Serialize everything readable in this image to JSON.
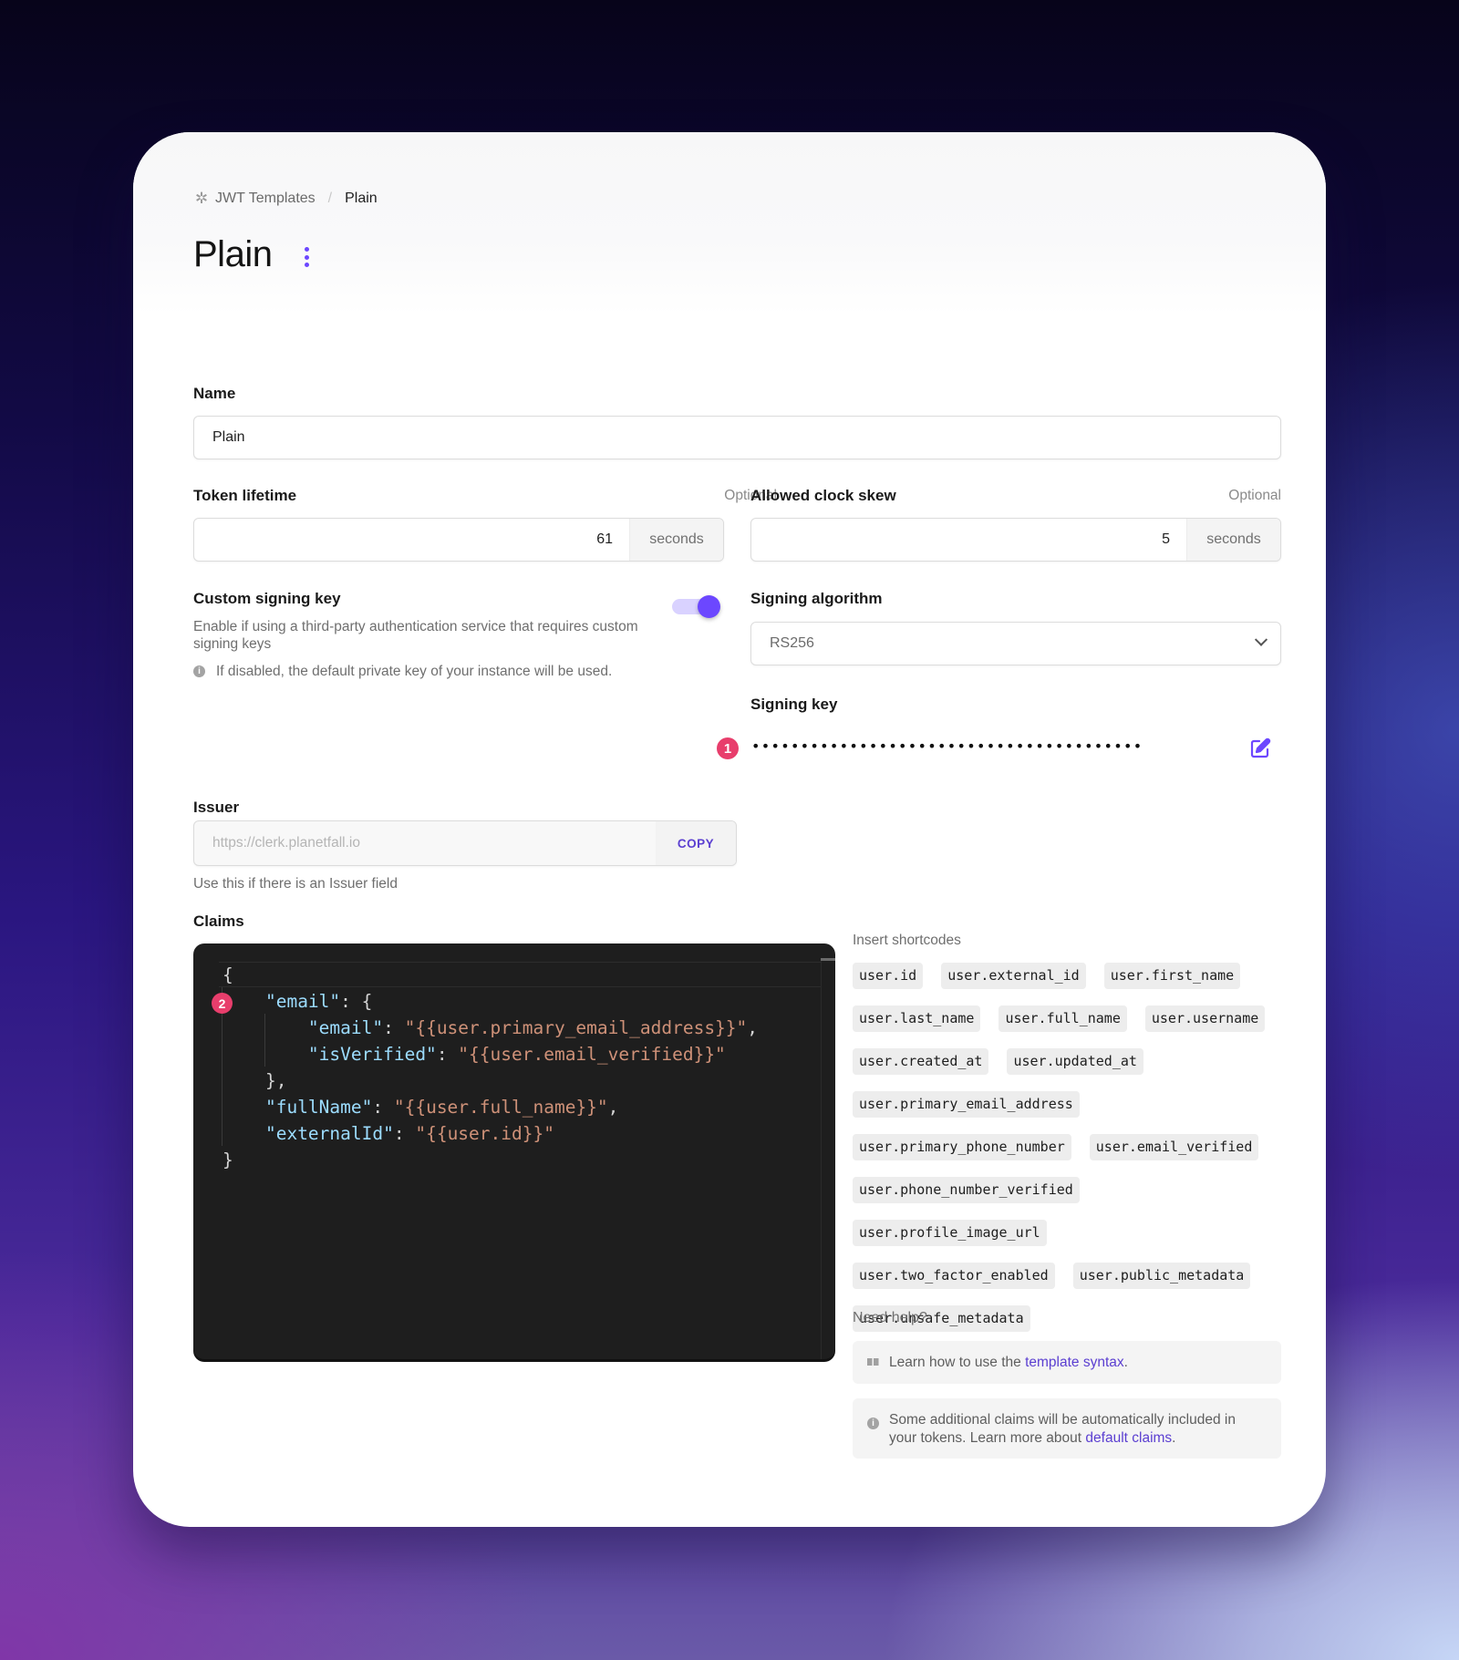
{
  "breadcrumb": {
    "parent": "JWT Templates",
    "separator": "/",
    "current": "Plain"
  },
  "page": {
    "title": "Plain"
  },
  "form": {
    "name": {
      "label": "Name",
      "value": "Plain"
    },
    "token_lifetime": {
      "label": "Token lifetime",
      "optional": "Optional",
      "value": "61",
      "unit": "seconds"
    },
    "clock_skew": {
      "label": "Allowed clock skew",
      "optional": "Optional",
      "value": "5",
      "unit": "seconds"
    },
    "custom_signing_key": {
      "label": "Custom signing key",
      "description": "Enable if using a third-party authentication service that requires custom signing keys",
      "note": "If disabled, the default private key of your instance will be used.",
      "enabled": true
    },
    "signing_algorithm": {
      "label": "Signing algorithm",
      "value": "RS256"
    },
    "signing_key": {
      "label": "Signing key",
      "masked": "••••••••••••••••••••••••••••••••••••••••",
      "badge": "1"
    },
    "issuer": {
      "label": "Issuer",
      "value": "https://clerk.planetfall.io",
      "copy_label": "COPY",
      "helper": "Use this if there is an Issuer field"
    },
    "claims": {
      "label": "Claims",
      "badge": "2",
      "lines": [
        [
          {
            "t": "p",
            "v": "{"
          }
        ],
        [
          {
            "t": "p",
            "v": "    "
          },
          {
            "t": "k",
            "v": "\"email\""
          },
          {
            "t": "p",
            "v": ": {"
          }
        ],
        [
          {
            "t": "p",
            "v": "        "
          },
          {
            "t": "k",
            "v": "\"email\""
          },
          {
            "t": "p",
            "v": ": "
          },
          {
            "t": "s",
            "v": "\"{{user.primary_email_address}}\""
          },
          {
            "t": "p",
            "v": ","
          }
        ],
        [
          {
            "t": "p",
            "v": "        "
          },
          {
            "t": "k",
            "v": "\"isVerified\""
          },
          {
            "t": "p",
            "v": ": "
          },
          {
            "t": "s",
            "v": "\"{{user.email_verified}}\""
          }
        ],
        [
          {
            "t": "p",
            "v": "    },"
          }
        ],
        [
          {
            "t": "p",
            "v": "    "
          },
          {
            "t": "k",
            "v": "\"fullName\""
          },
          {
            "t": "p",
            "v": ": "
          },
          {
            "t": "s",
            "v": "\"{{user.full_name}}\""
          },
          {
            "t": "p",
            "v": ","
          }
        ],
        [
          {
            "t": "p",
            "v": "    "
          },
          {
            "t": "k",
            "v": "\"externalId\""
          },
          {
            "t": "p",
            "v": ": "
          },
          {
            "t": "s",
            "v": "\"{{user.id}}\""
          }
        ],
        [
          {
            "t": "p",
            "v": "}"
          }
        ]
      ]
    }
  },
  "shortcodes": {
    "title": "Insert shortcodes",
    "items": [
      "user.id",
      "user.external_id",
      "user.first_name",
      "user.last_name",
      "user.full_name",
      "user.username",
      "user.created_at",
      "user.updated_at",
      "user.primary_email_address",
      "user.primary_phone_number",
      "user.email_verified",
      "user.phone_number_verified",
      "user.profile_image_url",
      "user.two_factor_enabled",
      "user.public_metadata",
      "user.unsafe_metadata"
    ]
  },
  "help": {
    "title": "Need help?",
    "syntax": {
      "prefix": "Learn how to use the ",
      "link": "template syntax",
      "suffix": "."
    },
    "claims": {
      "prefix": "Some additional claims will be automatically included in your tokens. Learn more about ",
      "link": "default claims",
      "suffix": "."
    }
  },
  "colors": {
    "accent": "#6c47ff",
    "badge": "#e83e6c",
    "editor_bg": "#1e1e1e"
  }
}
